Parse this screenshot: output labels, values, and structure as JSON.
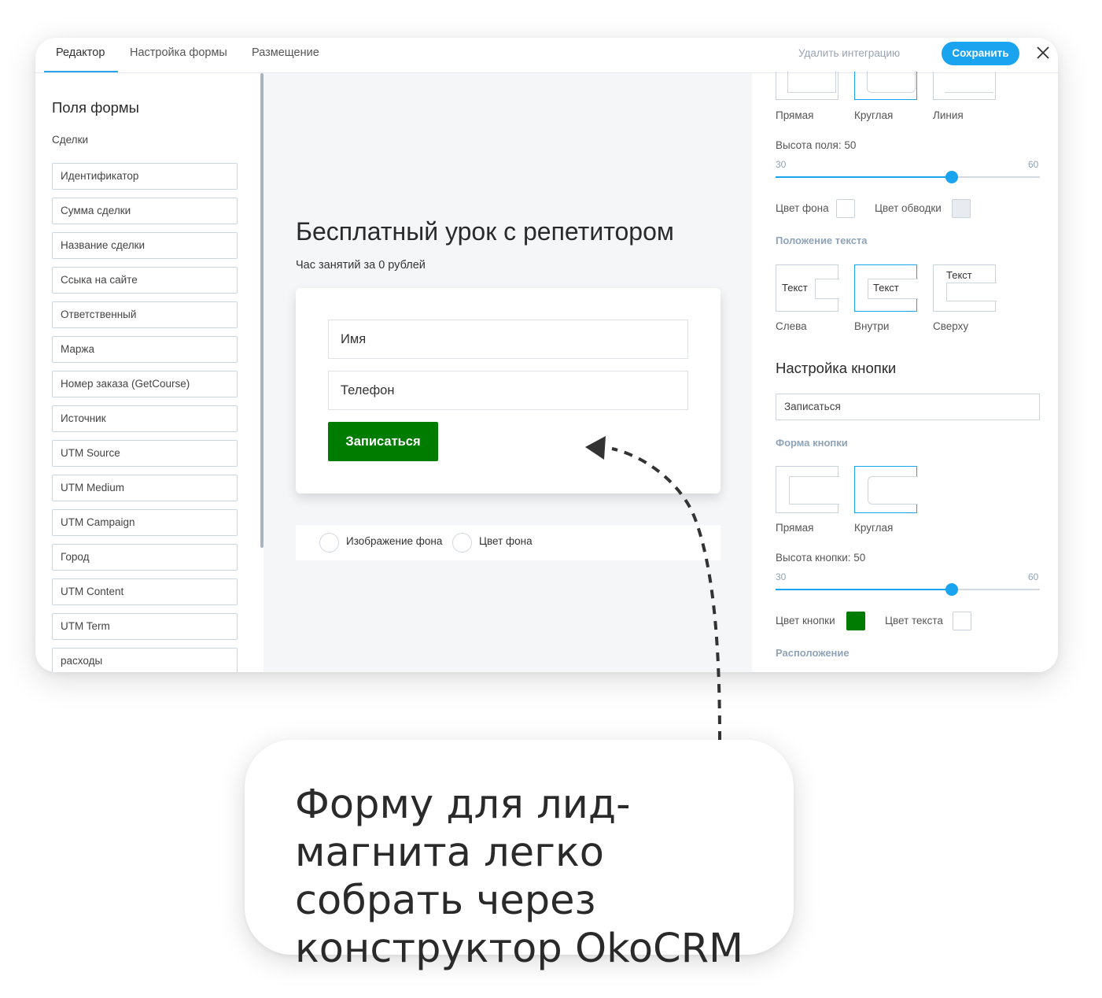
{
  "tabs": [
    {
      "label": "Редактор",
      "active": true
    },
    {
      "label": "Настройка формы",
      "active": false
    },
    {
      "label": "Размещение",
      "active": false
    }
  ],
  "topbar": {
    "delete_label": "Удалить интеграцию",
    "save_label": "Сохранить",
    "close_icon": "close-icon"
  },
  "left": {
    "title": "Поля формы",
    "subtitle": "Сделки",
    "fields": [
      "Идентификатор",
      "Сумма сделки",
      "Название сделки",
      "Ссыка на сайте",
      "Ответственный",
      "Маржа",
      "Номер заказа (GetCourse)",
      "Источник",
      "UTM Source",
      "UTM Medium",
      "UTM Campaign",
      "Город",
      "UTM Content",
      "UTM Term",
      "расходы"
    ]
  },
  "preview": {
    "title": "Бесплатный урок с репетитором",
    "subtitle": "Час занятий за 0 рублей",
    "name_placeholder": "Имя",
    "phone_placeholder": "Телефон",
    "button_label": "Записаться",
    "bg_image_label": "Изображение фона",
    "bg_color_label": "Цвет фона"
  },
  "right": {
    "field_shapes": [
      "Прямая",
      "Круглая",
      "Линия"
    ],
    "field_height_label": "Высота поля: 50",
    "field_height": {
      "min": "30",
      "max": "60",
      "value": 50
    },
    "bg_color_label": "Цвет фона",
    "border_color_label": "Цвет обводки",
    "text_position_head": "Положение текста",
    "text_sample": "Текст",
    "text_positions": [
      "Слева",
      "Внутри",
      "Сверху"
    ],
    "button_settings_title": "Настройка кнопки",
    "button_text_value": "Записаться",
    "button_shape_head": "Форма кнопки",
    "button_shapes": [
      "Прямая",
      "Круглая"
    ],
    "button_height_label": "Высота кнопки: 50",
    "button_height": {
      "min": "30",
      "max": "60",
      "value": 50
    },
    "button_color_label": "Цвет кнопки",
    "text_color_label": "Цвет текста",
    "placement_head": "Расположение"
  },
  "colors": {
    "accent": "#1aa4f0",
    "button_green": "#007c00",
    "border_swatch": "#e8ecf1",
    "text_swatch": "#ffffff",
    "bg_swatch": "#ffffff"
  },
  "callout": {
    "text": "Форму для лид-магнита легко собрать через конструктор OkoCRM"
  }
}
